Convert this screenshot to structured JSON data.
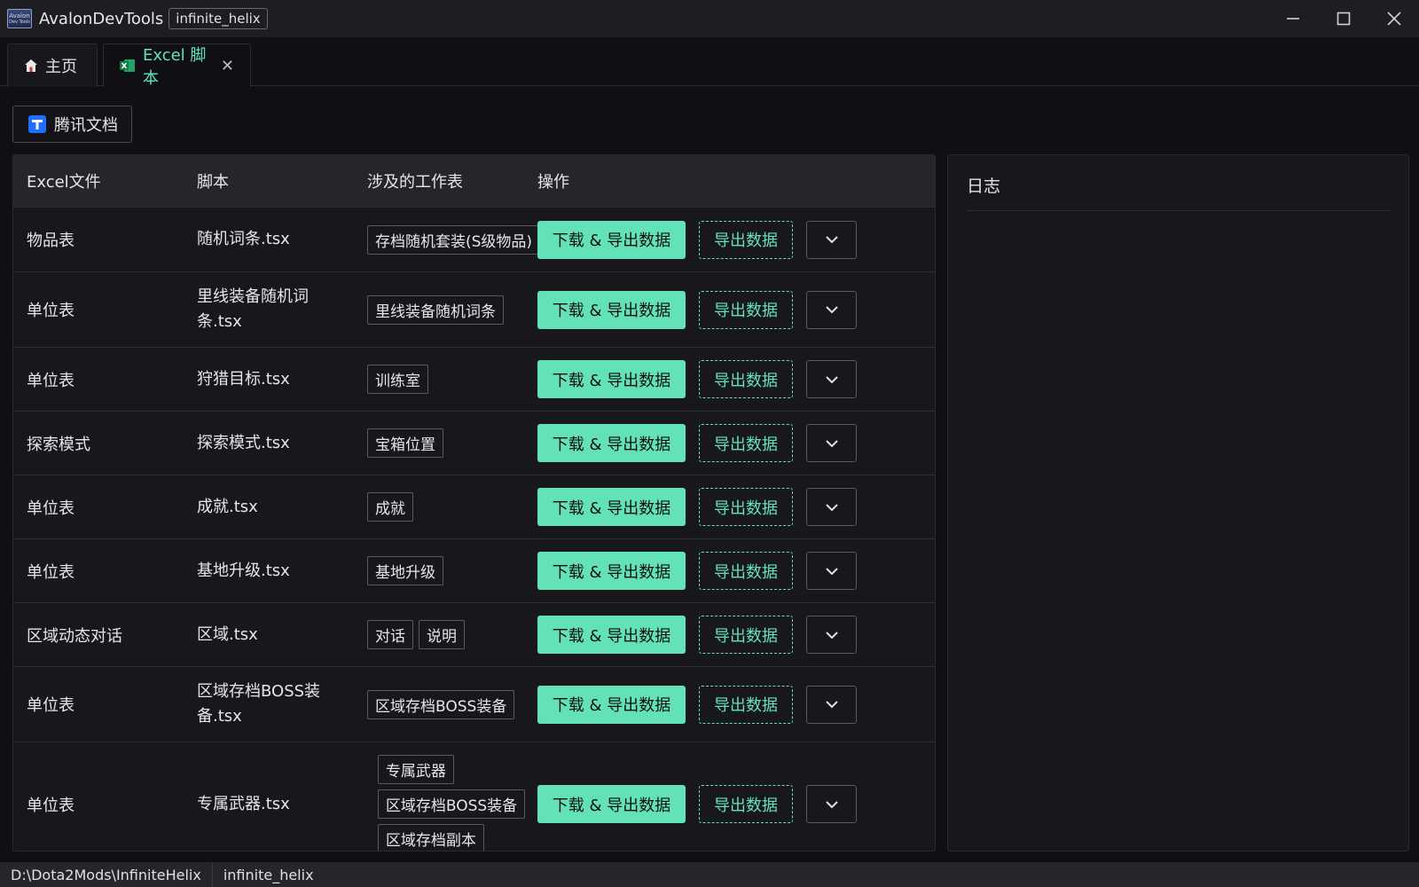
{
  "titlebar": {
    "app_title": "AvalonDevTools",
    "project": "infinite_helix",
    "logo_line1": "Avalon",
    "logo_line2": "Dev Tools"
  },
  "tabs": [
    {
      "label": "主页",
      "icon": "home-icon"
    },
    {
      "label": "Excel 脚本",
      "icon": "excel-icon"
    }
  ],
  "tencent_button": {
    "label": "腾讯文档",
    "icon": "tencent-docs-icon"
  },
  "table": {
    "headers": [
      "Excel文件",
      "脚本",
      "涉及的工作表",
      "操作"
    ],
    "primary_label": "下载 & 导出数据",
    "secondary_label": "导出数据",
    "rows": [
      {
        "file": "物品表",
        "script": "随机词条.tsx",
        "sheets": [
          "存档随机套装(S级物品)"
        ]
      },
      {
        "file": "单位表",
        "script": "里线装备随机词条.tsx",
        "sheets": [
          "里线装备随机词条"
        ]
      },
      {
        "file": "单位表",
        "script": "狩猎目标.tsx",
        "sheets": [
          "训练室"
        ]
      },
      {
        "file": "探索模式",
        "script": "探索模式.tsx",
        "sheets": [
          "宝箱位置"
        ]
      },
      {
        "file": "单位表",
        "script": "成就.tsx",
        "sheets": [
          "成就"
        ]
      },
      {
        "file": "单位表",
        "script": "基地升级.tsx",
        "sheets": [
          "基地升级"
        ]
      },
      {
        "file": "区域动态对话",
        "script": "区域.tsx",
        "sheets": [
          "对话",
          "说明"
        ]
      },
      {
        "file": "单位表",
        "script": "区域存档BOSS装备.tsx",
        "sheets": [
          "区域存档BOSS装备"
        ]
      },
      {
        "file": "单位表",
        "script": "专属武器.tsx",
        "sheets": [
          "专属武器",
          "区域存档BOSS装备",
          "区域存档副本"
        ]
      }
    ]
  },
  "log": {
    "title": "日志"
  },
  "statusbar": {
    "path": "D:\\Dota2Mods\\InfiniteHelix",
    "project": "infinite_helix"
  },
  "colors": {
    "accent": "#63e2b7",
    "background": "#101014",
    "panel": "#18181c"
  }
}
